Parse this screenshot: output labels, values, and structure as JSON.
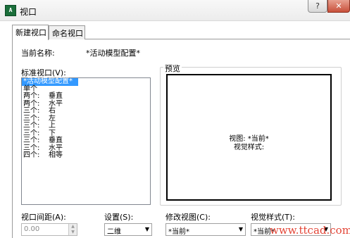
{
  "window": {
    "title": "视口",
    "icon_text": "AutoCAD",
    "help_label": "?",
    "close_label": "✕"
  },
  "tabs": [
    {
      "label": "新建视口",
      "active": true
    },
    {
      "label": "命名视口",
      "active": false
    }
  ],
  "current_name": {
    "label": "当前名称:",
    "value": "*活动模型配置*"
  },
  "standard_viewports": {
    "label": "标准视口(V):",
    "items": [
      {
        "c1": "*活动模型配置*",
        "c2": "",
        "selected": true
      },
      {
        "c1": "单个",
        "c2": ""
      },
      {
        "c1": "两个:",
        "c2": "垂直"
      },
      {
        "c1": "两个:",
        "c2": "水平"
      },
      {
        "c1": "三个:",
        "c2": "右"
      },
      {
        "c1": "三个:",
        "c2": "左"
      },
      {
        "c1": "三个:",
        "c2": "上"
      },
      {
        "c1": "三个:",
        "c2": "下"
      },
      {
        "c1": "三个:",
        "c2": "垂直"
      },
      {
        "c1": "三个:",
        "c2": "水平"
      },
      {
        "c1": "四个:",
        "c2": "相等"
      }
    ]
  },
  "preview": {
    "label": "预览",
    "line1": "视图: *当前*",
    "line2": "视觉样式:"
  },
  "viewport_spacing": {
    "label": "视口间距(A):",
    "value": "0.00"
  },
  "setup": {
    "label": "设置(S):",
    "value": "二维"
  },
  "change_view": {
    "label": "修改视图(C):",
    "value": "*当前*"
  },
  "visual_style": {
    "label": "视觉样式(T):",
    "value": "*当前*"
  },
  "watermark": {
    "text": "www.ttcad.com"
  }
}
